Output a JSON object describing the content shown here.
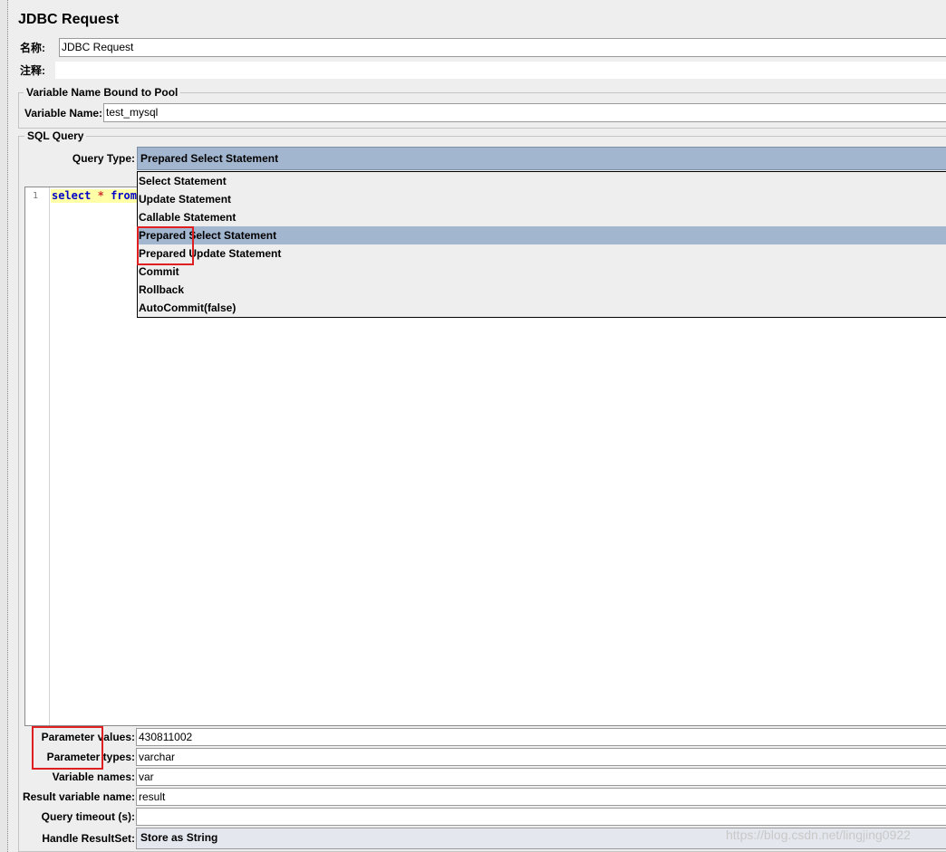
{
  "panel": {
    "title": "JDBC Request"
  },
  "name_row": {
    "label": "名称:",
    "value": "JDBC Request"
  },
  "comment_row": {
    "label": "注释:",
    "value": ""
  },
  "pool_group": {
    "legend": "Variable Name Bound to Pool",
    "variable_label": "Variable Name:",
    "variable_value": "test_mysql"
  },
  "sql_group": {
    "legend": "SQL Query",
    "query_type_label": "Query Type:",
    "query_type_value": "Prepared Select Statement",
    "query_type_options": [
      "Select Statement",
      "Update Statement",
      "Callable Statement",
      "Prepared Select Statement",
      "Prepared Update Statement",
      "Commit",
      "Rollback",
      "AutoCommit(false)"
    ],
    "selected_option_index": 3,
    "editor": {
      "line_number": "1",
      "code_keyword_1": "select",
      "code_op": "*",
      "code_keyword_2": "from"
    }
  },
  "params": {
    "values_label": "Parameter values:",
    "values_value": "430811002",
    "types_label": "Parameter types:",
    "types_value": "varchar",
    "var_names_label": "Variable names:",
    "var_names_value": "var",
    "result_var_label": "Result variable name:",
    "result_var_value": "result",
    "timeout_label": "Query timeout (s):",
    "timeout_value": "",
    "handle_label": "Handle ResultSet:",
    "handle_value": "Store as String"
  },
  "watermark": "https://blog.csdn.net/lingjing0922",
  "colors": {
    "selection": "#a3b6cf",
    "highlight_box": "#e02020",
    "keyword": "#0000c8",
    "operator": "#d12f2f"
  }
}
